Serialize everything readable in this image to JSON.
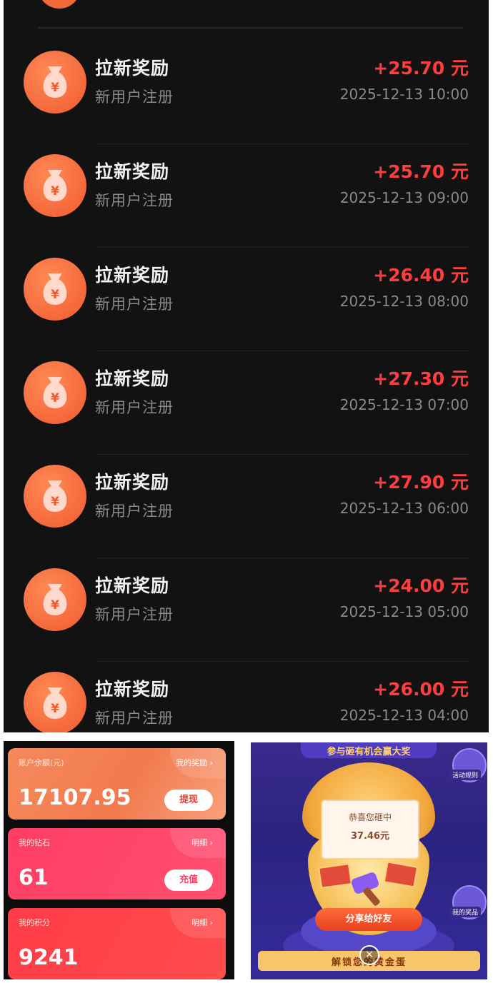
{
  "transactions": [
    {
      "title": "拉新奖励",
      "subtitle": "新用户注册",
      "amount": "+25.70 元",
      "time": "2025-12-13 10:00"
    },
    {
      "title": "拉新奖励",
      "subtitle": "新用户注册",
      "amount": "+25.70 元",
      "time": "2025-12-13 09:00"
    },
    {
      "title": "拉新奖励",
      "subtitle": "新用户注册",
      "amount": "+26.40 元",
      "time": "2025-12-13 08:00"
    },
    {
      "title": "拉新奖励",
      "subtitle": "新用户注册",
      "amount": "+27.30 元",
      "time": "2025-12-13 07:00"
    },
    {
      "title": "拉新奖励",
      "subtitle": "新用户注册",
      "amount": "+27.90 元",
      "time": "2025-12-13 06:00"
    },
    {
      "title": "拉新奖励",
      "subtitle": "新用户注册",
      "amount": "+24.00 元",
      "time": "2025-12-13 05:00"
    },
    {
      "title": "拉新奖励",
      "subtitle": "新用户注册",
      "amount": "+26.00 元",
      "time": "2025-12-13 04:00"
    }
  ],
  "wallet": {
    "balance": {
      "label": "账户余额(元)",
      "link": "我的奖励 ›",
      "value": "17107.95",
      "button": "提现"
    },
    "diamonds": {
      "label": "我的钻石",
      "link": "明细 ›",
      "value": "61",
      "button": "充值"
    },
    "points": {
      "label": "我的积分",
      "link": "明细 ›",
      "value": "9241"
    }
  },
  "promo": {
    "header": "参与砸有机会赢大奖",
    "coupon_title": "恭喜您砸中",
    "coupon_amount": "37.46元",
    "share_button": "分享给好友",
    "bottom_text": "解锁您的黄金蛋",
    "badge_left": "活动规则",
    "badge_right": "我的奖品"
  },
  "colors": {
    "amount": "#ff3f3f",
    "icon_bg": "#f05a30",
    "panel_bg": "#121212"
  },
  "icons": {
    "money_bag": "money-bag-icon",
    "close": "close-icon",
    "hammer": "hammer-icon"
  }
}
